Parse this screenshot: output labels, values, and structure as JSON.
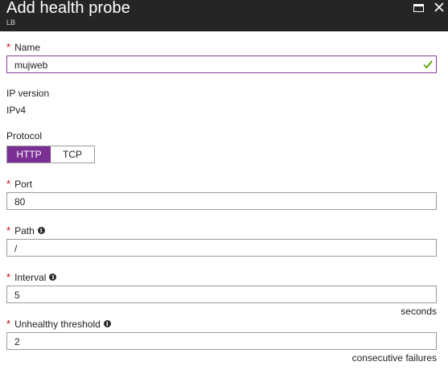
{
  "header": {
    "title": "Add health probe",
    "subtitle": "LB"
  },
  "form": {
    "name": {
      "label": "Name",
      "value": "mujweb"
    },
    "ip_version": {
      "label": "IP version",
      "value": "IPv4"
    },
    "protocol": {
      "label": "Protocol",
      "options": [
        "HTTP",
        "TCP"
      ],
      "selected": "HTTP"
    },
    "port": {
      "label": "Port",
      "value": "80"
    },
    "path": {
      "label": "Path",
      "value": "/"
    },
    "interval": {
      "label": "Interval",
      "value": "5",
      "unit": "seconds"
    },
    "unhealthy_threshold": {
      "label": "Unhealthy threshold",
      "value": "2",
      "unit": "consecutive failures"
    }
  },
  "required_marker": "*",
  "info_glyph": "i",
  "colors": {
    "header_bg": "#252525",
    "accent": "#7a2f94",
    "check": "#57a300",
    "required": "#c40000"
  }
}
